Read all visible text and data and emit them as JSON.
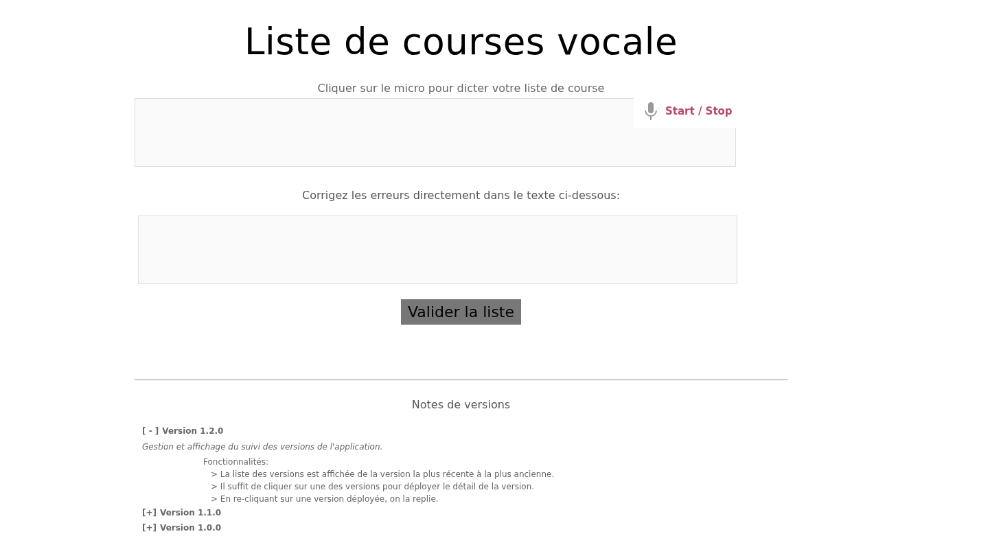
{
  "title": "Liste de courses vocale",
  "dictation": {
    "instruction": "Cliquer sur le micro pour dicter votre liste de course",
    "button": "Start / Stop"
  },
  "correction": {
    "instruction": "Corrigez les erreurs directement dans le texte ci-dessous:"
  },
  "submit_button": "Valider la liste",
  "release_notes": {
    "heading": "Notes de versions",
    "versions": [
      {
        "toggle": "[ - ]",
        "label": "Version 1.2.0",
        "description": "Gestion et affichage du suivi des versions de l'application.",
        "features_heading": "Fonctionnalités:",
        "features": [
          "> La liste des versions est affichée de la version la plus récente à la plus ancienne.",
          "> Il suffit de cliquer sur une des versions pour déployer le détail de la version.",
          "> En re-cliquant sur une version déployée, on la replie."
        ]
      },
      {
        "toggle": "[+]",
        "label": "Version 1.1.0"
      },
      {
        "toggle": "[+]",
        "label": "Version 1.0.0"
      }
    ]
  }
}
